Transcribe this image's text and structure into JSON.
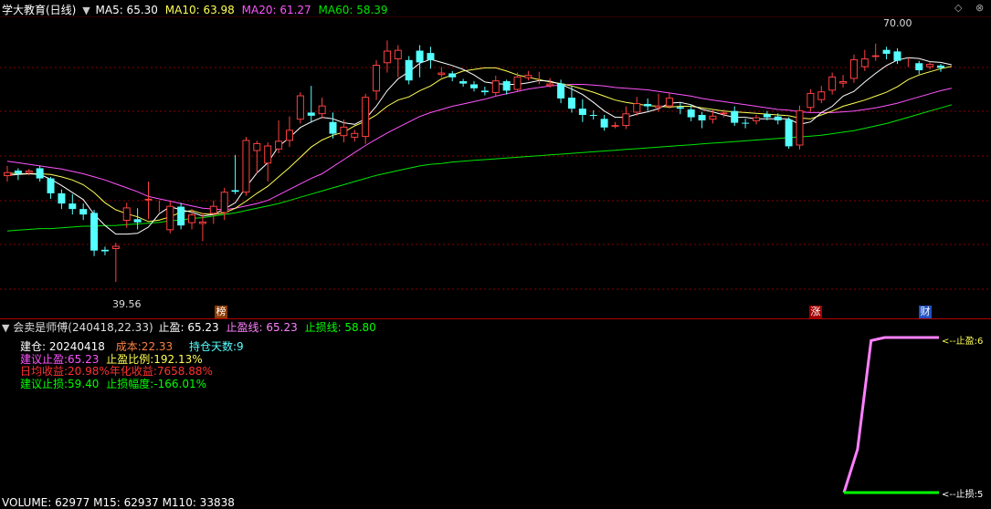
{
  "main_header": {
    "title": "学大教育(日线)",
    "ma5": "MA5: 65.30",
    "ma10": "MA10: 63.98",
    "ma20": "MA20: 61.27",
    "ma60": "MA60: 58.39"
  },
  "chart_labels": {
    "high": "70.00",
    "low": "39.56",
    "marker_1": "榜",
    "marker_2": "涨",
    "marker_3": "财"
  },
  "indicator_header": {
    "name": "会卖是师傅(240418,22.33)",
    "take_profit": "止盈: 65.23",
    "take_profit_line": "止盈线: 65.23",
    "stop_loss_line": "止损线: 58.80"
  },
  "info_panel": {
    "entry_label": "建仓: 20240418",
    "cost": "成本:22.33",
    "hold_days": "持仓天数:9",
    "suggest_tp": "建议止盈:65.23",
    "tp_ratio": "止盈比例:192.13%",
    "daily_return": "日均收益:20.98%",
    "annual_return": "年化收益:7658.88%",
    "suggest_sl": "建议止损:59.40",
    "sl_range": "止损幅度:-166.01%"
  },
  "right_labels": {
    "tp_tag": "<--止盈:6",
    "sl_tag": "<--止损:5"
  },
  "volume_header": {
    "text": "VOLUME: 62977  M15: 62937  M110: 33838"
  },
  "colors": {
    "up": "#ff4040",
    "down": "#54ffff",
    "ma5": "#ffffff",
    "ma10": "#ffff54",
    "ma20": "#ff54ff",
    "ma60": "#00e600",
    "grid": "#8a0000",
    "tp_line": "#ff80ff",
    "sl_line": "#00ff00"
  },
  "chart_data": {
    "type": "candlestick",
    "x_unit": "daily bars",
    "y_range": [
      36,
      73
    ],
    "candles": [
      {
        "o": 53.1,
        "c": 53.6,
        "h": 54.4,
        "l": 52.4
      },
      {
        "o": 53.8,
        "c": 53.4,
        "h": 54.1,
        "l": 52.6
      },
      {
        "o": 53.5,
        "c": 53.8,
        "h": 54.0,
        "l": 53.2
      },
      {
        "o": 54.1,
        "c": 52.8,
        "h": 54.4,
        "l": 52.4
      },
      {
        "o": 52.8,
        "c": 50.9,
        "h": 53.0,
        "l": 50.2
      },
      {
        "o": 50.9,
        "c": 49.6,
        "h": 51.4,
        "l": 48.9
      },
      {
        "o": 49.6,
        "c": 48.9,
        "h": 50.8,
        "l": 48.2
      },
      {
        "o": 48.9,
        "c": 48.2,
        "h": 49.6,
        "l": 47.5
      },
      {
        "o": 48.4,
        "c": 43.6,
        "h": 48.8,
        "l": 42.9
      },
      {
        "o": 43.7,
        "c": 43.5,
        "h": 44.1,
        "l": 43.0
      },
      {
        "o": 43.8,
        "c": 44.2,
        "h": 44.6,
        "l": 39.6
      },
      {
        "o": 47.4,
        "c": 49.1,
        "h": 49.7,
        "l": 46.5
      },
      {
        "o": 47.6,
        "c": 47.2,
        "h": 49.0,
        "l": 46.3
      },
      {
        "o": 50.0,
        "c": 50.2,
        "h": 52.4,
        "l": 47.6
      },
      {
        "o": 49.6,
        "c": 49.6,
        "h": 50.0,
        "l": 48.5
      },
      {
        "o": 46.2,
        "c": 49.3,
        "h": 49.9,
        "l": 45.8
      },
      {
        "o": 49.2,
        "c": 46.8,
        "h": 49.7,
        "l": 46.3
      },
      {
        "o": 47.1,
        "c": 48.2,
        "h": 48.9,
        "l": 46.3
      },
      {
        "o": 47.0,
        "c": 47.3,
        "h": 48.4,
        "l": 44.8
      },
      {
        "o": 48.3,
        "c": 49.3,
        "h": 50.0,
        "l": 47.0
      },
      {
        "o": 48.4,
        "c": 51.1,
        "h": 51.6,
        "l": 47.5
      },
      {
        "o": 51.3,
        "c": 51.1,
        "h": 55.8,
        "l": 50.8
      },
      {
        "o": 51.0,
        "c": 57.7,
        "h": 58.1,
        "l": 50.6
      },
      {
        "o": 56.3,
        "c": 57.3,
        "h": 57.6,
        "l": 53.4
      },
      {
        "o": 54.7,
        "c": 57.0,
        "h": 57.4,
        "l": 52.4
      },
      {
        "o": 56.5,
        "c": 57.6,
        "h": 60.2,
        "l": 56.0
      },
      {
        "o": 57.6,
        "c": 59.0,
        "h": 60.7,
        "l": 56.8
      },
      {
        "o": 60.3,
        "c": 63.4,
        "h": 63.8,
        "l": 59.8
      },
      {
        "o": 61.2,
        "c": 60.8,
        "h": 64.6,
        "l": 59.9
      },
      {
        "o": 61.0,
        "c": 62.1,
        "h": 63.1,
        "l": 60.4
      },
      {
        "o": 60.0,
        "c": 58.5,
        "h": 61.2,
        "l": 57.9
      },
      {
        "o": 58.2,
        "c": 59.4,
        "h": 60.3,
        "l": 57.4
      },
      {
        "o": 58.0,
        "c": 58.6,
        "h": 59.0,
        "l": 57.5
      },
      {
        "o": 58.1,
        "c": 63.2,
        "h": 63.6,
        "l": 57.2
      },
      {
        "o": 63.9,
        "c": 67.3,
        "h": 67.9,
        "l": 62.8
      },
      {
        "o": 67.5,
        "c": 69.1,
        "h": 70.4,
        "l": 66.3
      },
      {
        "o": 68.0,
        "c": 69.2,
        "h": 69.8,
        "l": 65.7
      },
      {
        "o": 67.9,
        "c": 65.3,
        "h": 68.4,
        "l": 64.8
      },
      {
        "o": 69.1,
        "c": 67.6,
        "h": 69.8,
        "l": 65.7
      },
      {
        "o": 68.8,
        "c": 67.9,
        "h": 69.6,
        "l": 66.8
      },
      {
        "o": 66.0,
        "c": 66.3,
        "h": 67.0,
        "l": 65.7
      },
      {
        "o": 66.2,
        "c": 65.7,
        "h": 66.5,
        "l": 65.2
      },
      {
        "o": 65.2,
        "c": 64.9,
        "h": 65.5,
        "l": 64.5
      },
      {
        "o": 64.8,
        "c": 64.3,
        "h": 65.2,
        "l": 63.9
      },
      {
        "o": 64.0,
        "c": 63.8,
        "h": 64.5,
        "l": 63.4
      },
      {
        "o": 63.7,
        "c": 65.3,
        "h": 65.9,
        "l": 63.3
      },
      {
        "o": 65.2,
        "c": 64.0,
        "h": 65.4,
        "l": 63.5
      },
      {
        "o": 64.1,
        "c": 65.8,
        "h": 66.3,
        "l": 63.8
      },
      {
        "o": 65.6,
        "c": 66.0,
        "h": 66.5,
        "l": 65.3
      },
      {
        "o": 65.7,
        "c": 65.7,
        "h": 66.4,
        "l": 64.8
      },
      {
        "o": 64.6,
        "c": 64.9,
        "h": 65.6,
        "l": 64.4
      },
      {
        "o": 64.9,
        "c": 63.0,
        "h": 65.4,
        "l": 62.4
      },
      {
        "o": 63.1,
        "c": 61.7,
        "h": 64.6,
        "l": 61.2
      },
      {
        "o": 61.7,
        "c": 60.9,
        "h": 62.9,
        "l": 60.0
      },
      {
        "o": 60.9,
        "c": 60.8,
        "h": 61.5,
        "l": 60.3
      },
      {
        "o": 60.4,
        "c": 59.3,
        "h": 60.9,
        "l": 58.9
      },
      {
        "o": 59.4,
        "c": 59.6,
        "h": 60.0,
        "l": 59.2
      },
      {
        "o": 59.5,
        "c": 61.1,
        "h": 62.0,
        "l": 59.1
      },
      {
        "o": 61.2,
        "c": 62.4,
        "h": 63.2,
        "l": 60.8
      },
      {
        "o": 62.3,
        "c": 62.0,
        "h": 63.0,
        "l": 61.4
      },
      {
        "o": 61.8,
        "c": 62.1,
        "h": 63.6,
        "l": 61.3
      },
      {
        "o": 62.0,
        "c": 63.1,
        "h": 63.7,
        "l": 61.7
      },
      {
        "o": 61.9,
        "c": 61.7,
        "h": 62.4,
        "l": 61.0
      },
      {
        "o": 61.6,
        "c": 60.6,
        "h": 62.2,
        "l": 60.1
      },
      {
        "o": 60.9,
        "c": 60.2,
        "h": 61.3,
        "l": 59.2
      },
      {
        "o": 60.3,
        "c": 60.8,
        "h": 61.5,
        "l": 59.8
      },
      {
        "o": 61.0,
        "c": 61.2,
        "h": 61.6,
        "l": 60.6
      },
      {
        "o": 61.4,
        "c": 59.9,
        "h": 62.0,
        "l": 59.5
      },
      {
        "o": 59.9,
        "c": 59.8,
        "h": 60.4,
        "l": 59.2
      },
      {
        "o": 60.1,
        "c": 60.6,
        "h": 60.9,
        "l": 59.7
      },
      {
        "o": 61.0,
        "c": 60.6,
        "h": 61.4,
        "l": 60.2
      },
      {
        "o": 60.7,
        "c": 60.2,
        "h": 61.1,
        "l": 59.7
      },
      {
        "o": 60.3,
        "c": 56.9,
        "h": 60.6,
        "l": 56.6
      },
      {
        "o": 57.0,
        "c": 61.5,
        "h": 62.1,
        "l": 56.5
      },
      {
        "o": 61.8,
        "c": 63.7,
        "h": 64.2,
        "l": 61.3
      },
      {
        "o": 62.8,
        "c": 63.9,
        "h": 64.6,
        "l": 62.4
      },
      {
        "o": 64.0,
        "c": 65.8,
        "h": 66.3,
        "l": 63.5
      },
      {
        "o": 64.9,
        "c": 65.2,
        "h": 66.0,
        "l": 64.4
      },
      {
        "o": 65.5,
        "c": 68.0,
        "h": 68.6,
        "l": 65.0
      },
      {
        "o": 67.0,
        "c": 68.1,
        "h": 69.2,
        "l": 66.5
      },
      {
        "o": 68.3,
        "c": 68.5,
        "h": 70.0,
        "l": 67.8
      },
      {
        "o": 69.2,
        "c": 68.7,
        "h": 69.6,
        "l": 68.0
      },
      {
        "o": 69.0,
        "c": 67.8,
        "h": 69.4,
        "l": 67.4
      },
      {
        "o": 67.6,
        "c": 67.6,
        "h": 68.2,
        "l": 67.0
      },
      {
        "o": 67.5,
        "c": 66.6,
        "h": 67.8,
        "l": 66.1
      },
      {
        "o": 67.0,
        "c": 67.4,
        "h": 67.6,
        "l": 66.7
      },
      {
        "o": 67.2,
        "c": 66.9,
        "h": 67.4,
        "l": 66.4
      }
    ],
    "ma5": [
      53.2,
      53.3,
      53.4,
      53.3,
      52.7,
      51.9,
      51.0,
      50.1,
      48.2,
      46.8,
      45.7,
      45.7,
      45.8,
      46.6,
      48.3,
      49.2,
      48.8,
      48.5,
      48.0,
      48.2,
      48.9,
      49.7,
      51.7,
      53.5,
      54.8,
      56.9,
      58.0,
      59.3,
      60.0,
      60.6,
      60.4,
      59.9,
      59.7,
      60.4,
      62.0,
      64.0,
      65.5,
      66.4,
      67.5,
      68.0,
      67.6,
      67.2,
      66.7,
      66.0,
      65.1,
      64.9,
      64.8,
      64.8,
      65.0,
      65.3,
      65.2,
      64.8,
      64.2,
      63.5,
      62.5,
      61.4,
      60.6,
      60.6,
      61.0,
      61.3,
      61.7,
      62.4,
      62.5,
      62.2,
      61.6,
      61.3,
      60.9,
      60.6,
      60.6,
      60.4,
      60.4,
      60.4,
      60.4,
      59.7,
      60.0,
      61.2,
      62.0,
      63.3,
      63.9,
      65.1,
      66.2,
      67.2,
      67.9,
      68.2,
      68.1,
      67.7,
      67.6,
      67.3
    ],
    "ma10": [
      53.5,
      53.4,
      53.4,
      53.4,
      53.3,
      53.0,
      52.6,
      52.0,
      51.0,
      49.7,
      48.8,
      48.3,
      47.9,
      47.3,
      47.5,
      47.9,
      48.5,
      48.7,
      48.3,
      48.2,
      48.4,
      49.0,
      49.9,
      50.9,
      51.8,
      53.0,
      54.2,
      55.5,
      56.8,
      57.7,
      58.3,
      58.7,
      59.5,
      60.1,
      60.9,
      62.0,
      62.8,
      63.2,
      64.0,
      64.6,
      65.5,
      66.0,
      66.5,
      66.7,
      66.9,
      66.9,
      66.5,
      66.0,
      65.7,
      65.4,
      65.1,
      64.9,
      64.6,
      64.2,
      63.8,
      63.3,
      62.8,
      62.5,
      62.3,
      62.1,
      62.0,
      61.9,
      62.0,
      62.0,
      61.8,
      61.6,
      61.4,
      61.3,
      61.2,
      61.1,
      61.0,
      60.9,
      60.8,
      60.5,
      60.4,
      60.9,
      61.4,
      62.0,
      62.4,
      62.8,
      63.3,
      63.8,
      64.5,
      65.4,
      66.0,
      66.4,
      66.8,
      67.1
    ],
    "ma20": [
      55.0,
      54.8,
      54.6,
      54.4,
      54.2,
      54.0,
      53.7,
      53.4,
      53.0,
      52.6,
      52.1,
      51.6,
      51.1,
      50.5,
      50.2,
      49.9,
      49.6,
      49.3,
      49.0,
      48.9,
      48.8,
      49.0,
      49.3,
      49.6,
      50.0,
      50.7,
      51.4,
      52.1,
      52.8,
      53.4,
      54.3,
      55.2,
      56.1,
      57.0,
      57.8,
      58.6,
      59.3,
      60.0,
      60.7,
      61.2,
      61.6,
      62.0,
      62.3,
      62.6,
      62.9,
      63.3,
      63.6,
      63.9,
      64.2,
      64.4,
      64.6,
      64.7,
      64.8,
      64.8,
      64.7,
      64.6,
      64.4,
      64.3,
      64.2,
      64.1,
      63.9,
      63.7,
      63.5,
      63.3,
      63.0,
      62.8,
      62.6,
      62.4,
      62.2,
      62.0,
      61.8,
      61.6,
      61.5,
      61.3,
      61.2,
      61.2,
      61.2,
      61.3,
      61.4,
      61.6,
      61.8,
      62.1,
      62.4,
      62.8,
      63.2,
      63.6,
      64.0,
      64.3
    ],
    "ma60": [
      46.1,
      46.2,
      46.3,
      46.4,
      46.4,
      46.5,
      46.6,
      46.7,
      46.7,
      46.8,
      46.8,
      46.9,
      47.0,
      47.1,
      47.2,
      47.4,
      47.5,
      47.7,
      47.8,
      48.0,
      48.2,
      48.4,
      48.7,
      49.0,
      49.3,
      49.6,
      50.0,
      50.4,
      50.8,
      51.2,
      51.6,
      52.0,
      52.4,
      52.8,
      53.2,
      53.5,
      53.8,
      54.1,
      54.4,
      54.6,
      54.7,
      54.9,
      55.0,
      55.1,
      55.2,
      55.3,
      55.4,
      55.5,
      55.6,
      55.7,
      55.8,
      55.9,
      56.0,
      56.1,
      56.2,
      56.3,
      56.4,
      56.5,
      56.6,
      56.7,
      56.8,
      56.9,
      57.0,
      57.1,
      57.2,
      57.3,
      57.4,
      57.5,
      57.6,
      57.7,
      57.8,
      57.9,
      58.0,
      58.1,
      58.2,
      58.3,
      58.5,
      58.7,
      58.9,
      59.2,
      59.5,
      59.8,
      60.2,
      60.6,
      61.0,
      61.4,
      61.8,
      62.2
    ],
    "tp_curve": [
      0.0,
      0.28,
      0.98,
      1.0,
      1.0,
      1.0,
      1.0,
      1.0
    ],
    "sl_level": 0.0
  }
}
